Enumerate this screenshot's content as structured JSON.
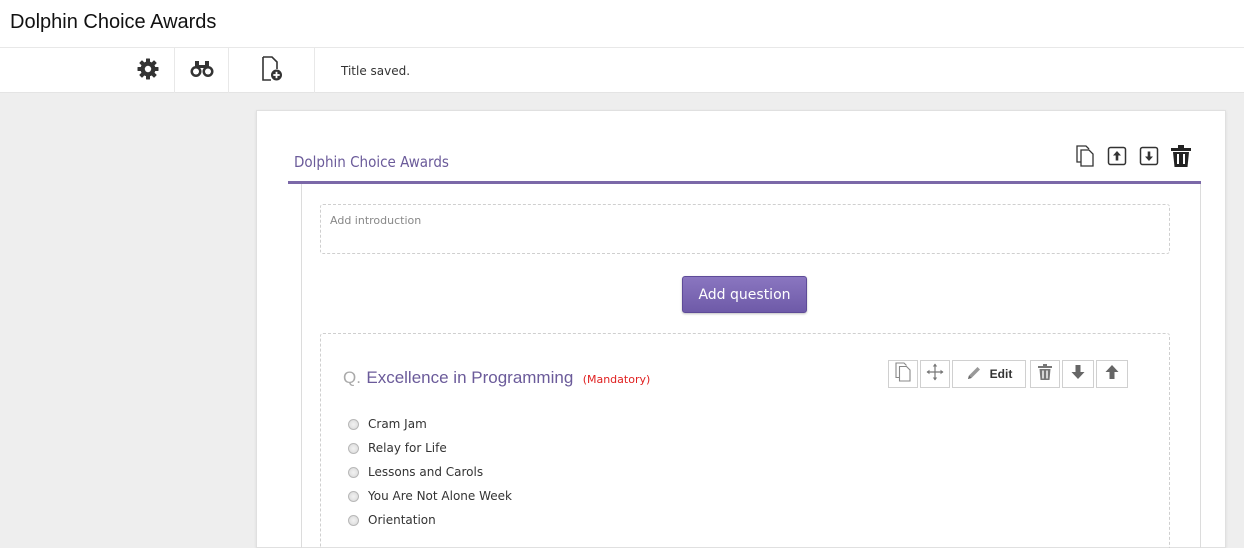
{
  "app": {
    "title": "Dolphin Choice Awards"
  },
  "toolbar": {
    "tools": [
      {
        "icon": "gear-icon"
      },
      {
        "icon": "binoculars-icon"
      },
      {
        "icon": "new-document-icon"
      }
    ],
    "status": "Title saved."
  },
  "survey": {
    "title": "Dolphin Choice Awards",
    "title_tools": [
      "copy-icon",
      "export-icon",
      "import-icon",
      "trash-icon"
    ],
    "intro_placeholder": "Add introduction",
    "add_question_label": "Add question"
  },
  "question": {
    "prefix": "Q.",
    "title": "Excellence in Programming",
    "mandatory_label": "(Mandatory)",
    "edit_label": "Edit",
    "tools": [
      "copy-icon",
      "move-icon",
      "edit-pencil-icon",
      "trash-icon",
      "arrow-down-icon",
      "arrow-up-icon"
    ],
    "options": [
      "Cram Jam",
      "Relay for Life",
      "Lessons and Carols",
      "You Are Not Alone Week",
      "Orientation"
    ]
  },
  "colors": {
    "accent": "#6b5b9a",
    "button": "#7b68b5",
    "mandatory": "#e02020",
    "canvas": "#eeeeee"
  }
}
